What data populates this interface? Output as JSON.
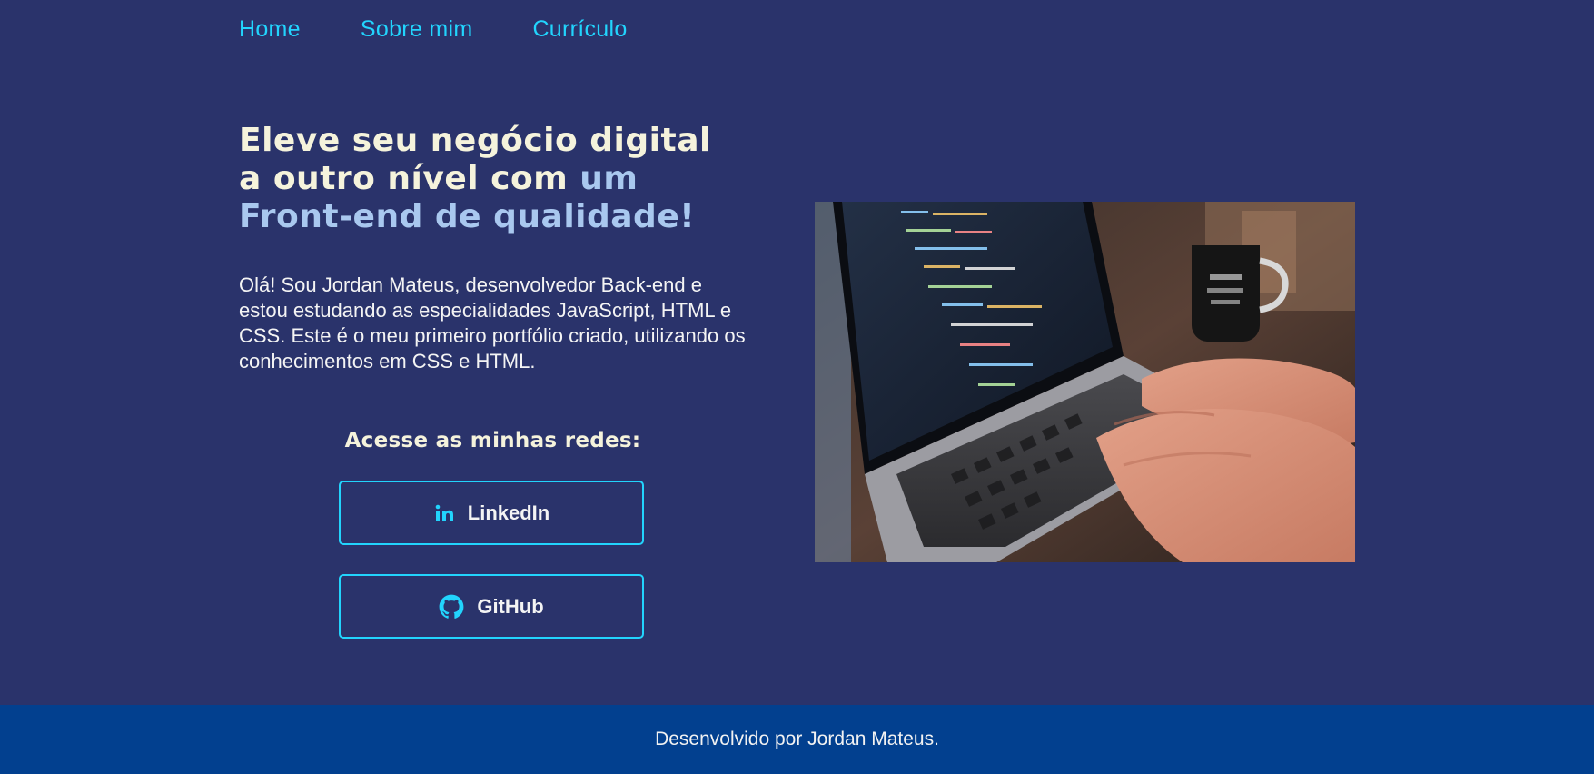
{
  "nav": {
    "items": [
      {
        "label": "Home"
      },
      {
        "label": "Sobre mim"
      },
      {
        "label": "Currículo"
      }
    ]
  },
  "hero": {
    "headline_line1": "Eleve seu negócio digital",
    "headline_line2_plain": "a outro nível com ",
    "headline_line2_highlight": "um",
    "headline_line3": "Front-end de qualidade!",
    "bio": "Olá! Sou Jordan Mateus, desenvolvedor Back-end e estou estudando as especialidades JavaScript, HTML e CSS. Este é o meu primeiro portfólio criado, utilizando os conhecimentos em CSS e HTML."
  },
  "networks": {
    "title": "Acesse as minhas redes:",
    "linkedin": {
      "label": "LinkedIn",
      "icon": "linkedin-icon"
    },
    "github": {
      "label": "GitHub",
      "icon": "github-icon"
    }
  },
  "photo": {
    "subject": "laptop-with-code-and-typing-hands"
  },
  "footer": {
    "text": "Desenvolvido por Jordan Mateus."
  },
  "colors": {
    "background": "#2a336b",
    "accent": "#22d4fd",
    "headline": "#f5f3dc",
    "highlight": "#a9c8ef",
    "footer": "#02408f"
  }
}
